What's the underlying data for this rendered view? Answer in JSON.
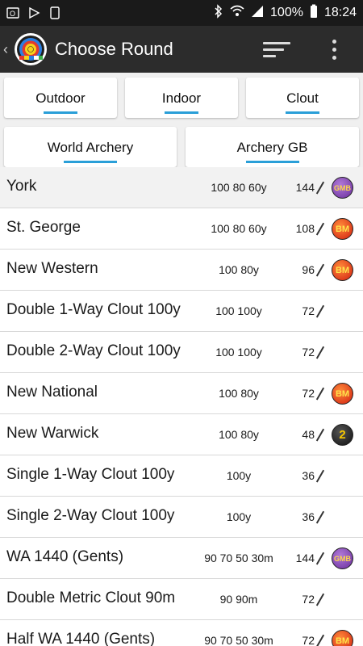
{
  "status_bar": {
    "battery": "100%",
    "time": "18:24"
  },
  "app_bar": {
    "title": "Choose Round"
  },
  "tabs": {
    "row1": [
      "Outdoor",
      "Indoor",
      "Clout"
    ],
    "row2": [
      "World Archery",
      "Archery GB"
    ]
  },
  "rounds": [
    {
      "name": "York",
      "distances": "100 80 60y",
      "arrows": "144",
      "badge": "GMB"
    },
    {
      "name": "St. George",
      "distances": "100 80 60y",
      "arrows": "108",
      "badge": "BM"
    },
    {
      "name": "New Western",
      "distances": "100 80y",
      "arrows": "96",
      "badge": "BM"
    },
    {
      "name": "Double 1-Way Clout 100y",
      "distances": "100 100y",
      "arrows": "72",
      "badge": ""
    },
    {
      "name": "Double 2-Way Clout 100y",
      "distances": "100 100y",
      "arrows": "72",
      "badge": ""
    },
    {
      "name": "New National",
      "distances": "100 80y",
      "arrows": "72",
      "badge": "BM"
    },
    {
      "name": "New Warwick",
      "distances": "100 80y",
      "arrows": "48",
      "badge": "2"
    },
    {
      "name": "Single 1-Way Clout 100y",
      "distances": "100y",
      "arrows": "36",
      "badge": ""
    },
    {
      "name": "Single 2-Way Clout 100y",
      "distances": "100y",
      "arrows": "36",
      "badge": ""
    },
    {
      "name": "WA 1440 (Gents)",
      "distances": "90 70 50 30m",
      "arrows": "144",
      "badge": "GMB"
    },
    {
      "name": "Double Metric Clout 90m",
      "distances": "90 90m",
      "arrows": "72",
      "badge": ""
    },
    {
      "name": "Half WA 1440 (Gents)",
      "distances": "90 70 50 30m",
      "arrows": "72",
      "badge": "BM"
    }
  ],
  "colors": {
    "accent": "#2a9fd8",
    "appbar": "#2c2c2c",
    "statusbar": "#1a1a1a"
  },
  "icons": [
    "outlook-icon",
    "play-store-icon",
    "phone-icon",
    "bluetooth-icon",
    "wifi-icon",
    "signal-icon",
    "battery-icon",
    "back-chevron-icon",
    "archery-target-logo",
    "sort-icon",
    "more-vert-icon",
    "arrow-icon"
  ]
}
